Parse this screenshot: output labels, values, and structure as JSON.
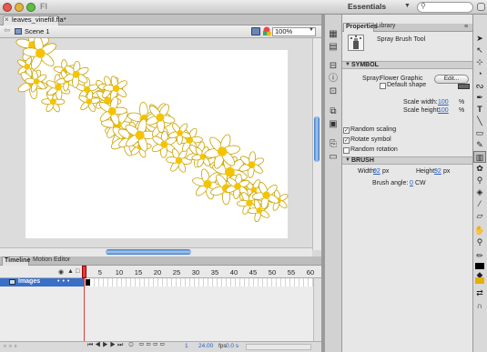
{
  "window": {
    "app_name": "Fl",
    "workspace": "Essentials"
  },
  "document": {
    "tab_label": "leaves_vinefill.fla*",
    "scene_label": "Scene 1",
    "zoom": "100%"
  },
  "timeline": {
    "tabs": [
      "Timeline",
      "Motion Editor"
    ],
    "frame_numbers": [
      "1",
      "5",
      "10",
      "15",
      "20",
      "25",
      "30",
      "35",
      "40",
      "45",
      "50",
      "55",
      "60"
    ],
    "layer_name": "Images",
    "current_frame": "1",
    "fps": "24.00",
    "fps_unit": "fps",
    "seconds": "0.0 s"
  },
  "properties": {
    "tabs": [
      "Properties",
      "Library"
    ],
    "tool_name": "Spray Brush Tool",
    "symbol_section": "SYMBOL",
    "spray_label": "Spray:",
    "spray_value": "Flower Graphic",
    "edit_button": "Edit...",
    "default_shape_label": "Default shape",
    "scale_width_label": "Scale width:",
    "scale_width_value": "100",
    "scale_height_label": "Scale height:",
    "scale_height_value": "100",
    "percent": "%",
    "random_scaling_label": "Random scaling",
    "rotate_symbol_label": "Rotate symbol",
    "random_rotation_label": "Random rotation",
    "brush_section": "BRUSH",
    "width_label": "Width:",
    "width_value": "92",
    "height_label": "Height:",
    "height_value": "92",
    "unit_px": "px",
    "brush_angle_label": "Brush angle:",
    "brush_angle_value": "0",
    "brush_angle_unit": "CW",
    "checks": {
      "default_shape": false,
      "random_scaling": true,
      "rotate_symbol": true,
      "random_rotation": false
    }
  },
  "colors": {
    "flower_center": "#f5c400",
    "petal_fill": "#ffffff",
    "petal_stroke": "#c9a300",
    "accent": "#3a6fc8",
    "fill_color": "#e5b000",
    "stroke_color": "#000000"
  }
}
